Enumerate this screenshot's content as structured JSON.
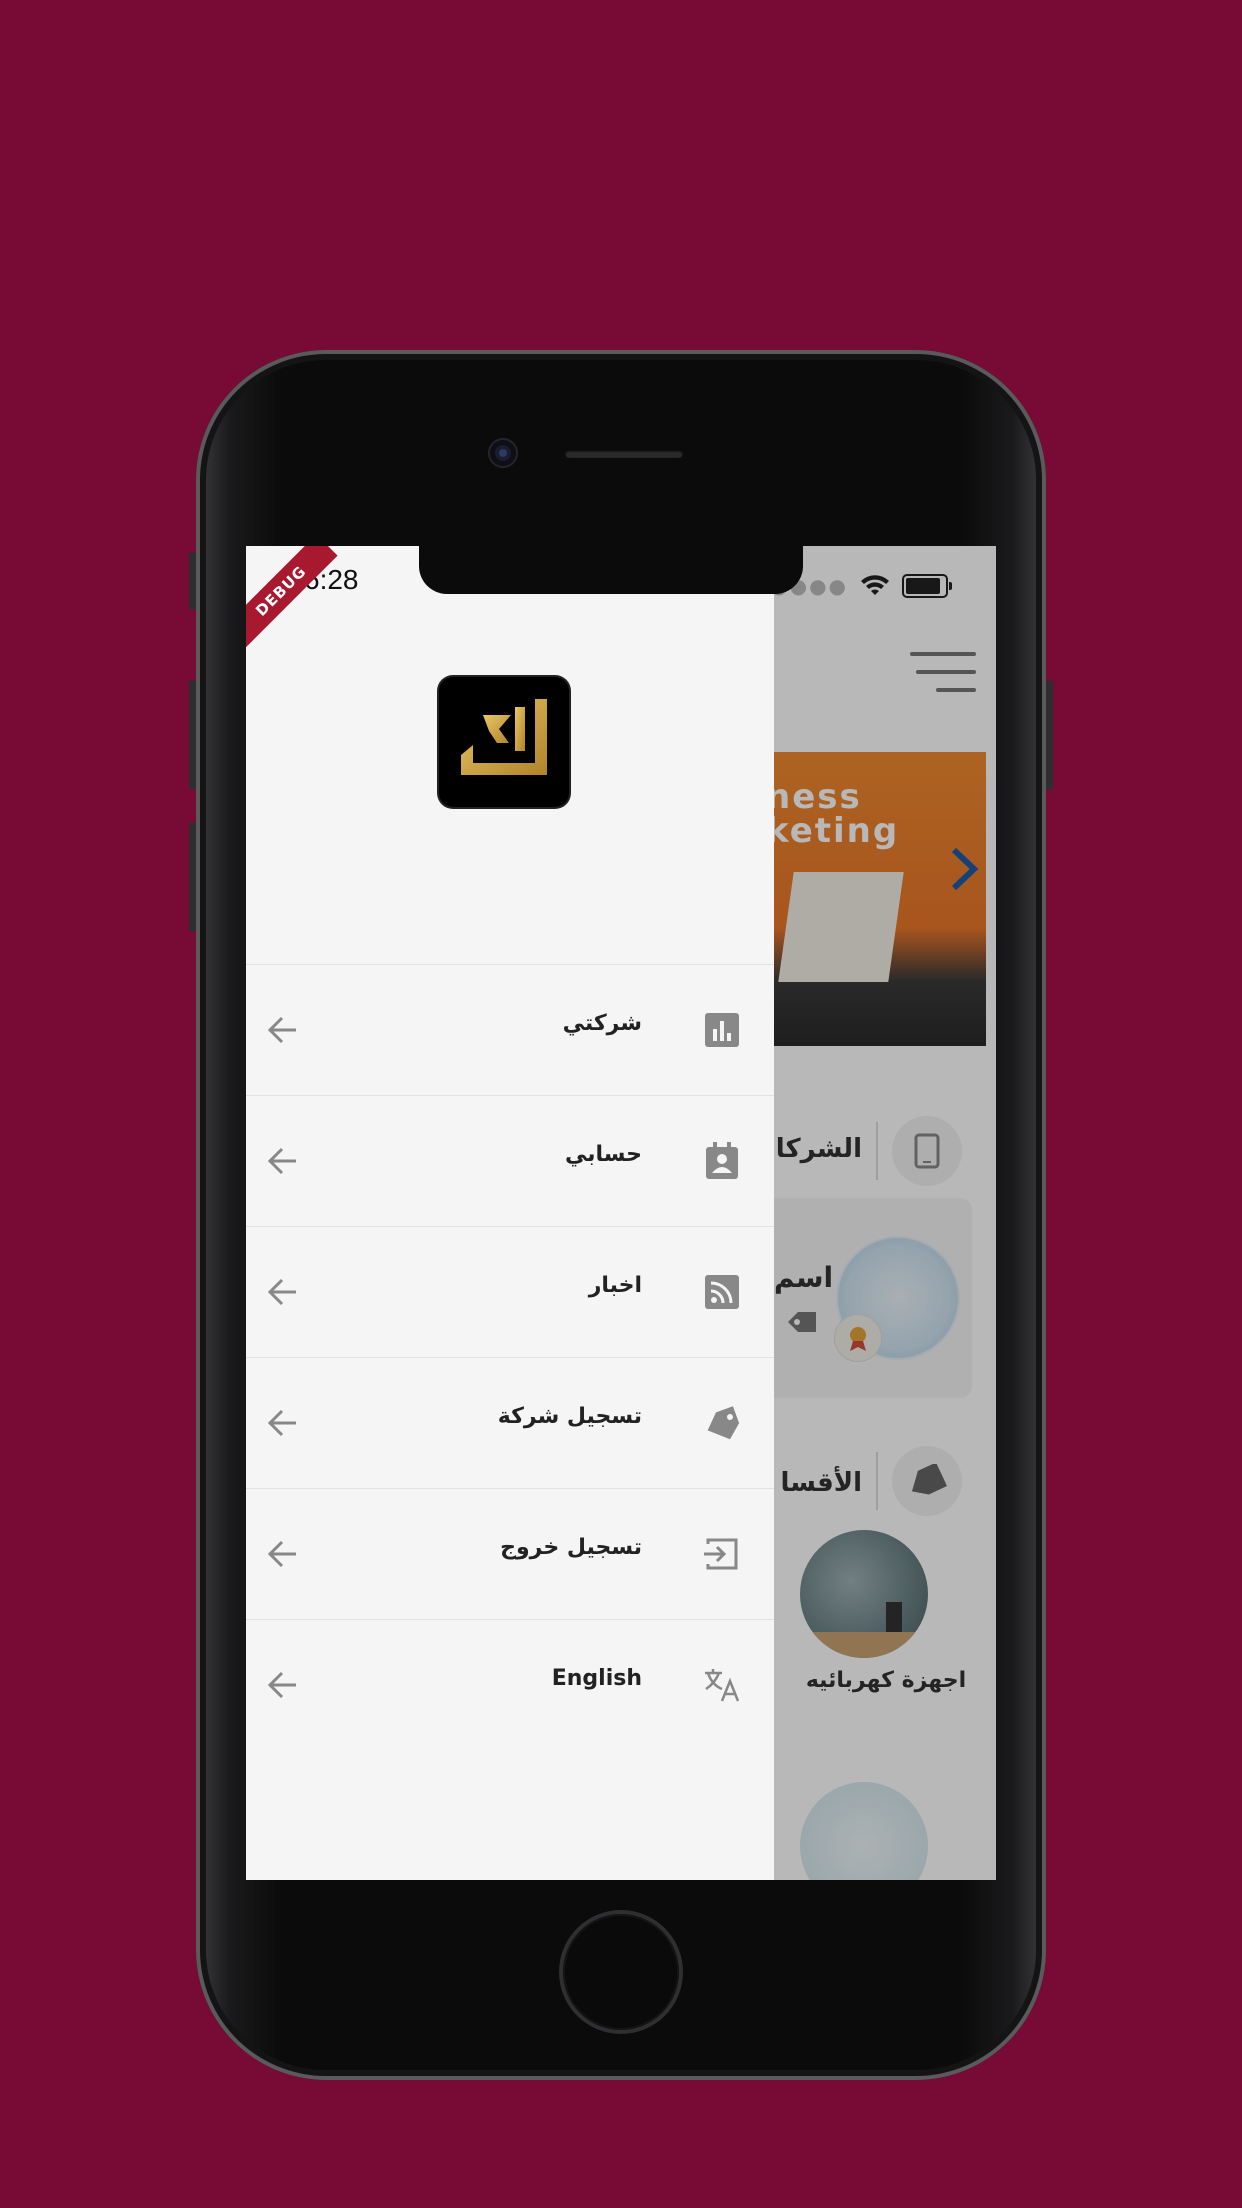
{
  "status_bar": {
    "time": "6:28",
    "debug_banner": "DEBUG"
  },
  "drawer": {
    "items": [
      {
        "label": "شركتي",
        "icon": "bar-chart-icon"
      },
      {
        "label": "حسابي",
        "icon": "contact-card-icon"
      },
      {
        "label": "اخبار",
        "icon": "rss-feed-icon"
      },
      {
        "label": "تسجيل شركة",
        "icon": "tag-icon"
      },
      {
        "label": "تسجيل خروج",
        "icon": "logout-icon"
      },
      {
        "label": "English",
        "icon": "translate-icon"
      }
    ]
  },
  "background": {
    "banner_text": "ness\nketing",
    "companies_section_title": "الشركا",
    "company_name": "اسم",
    "categories_section_title": "الأقسا",
    "category_label": "اجهزة كهربائيه"
  },
  "colors": {
    "page_background": "#780b35",
    "drawer_background": "#f5f5f5",
    "banner": "#ec7d2c",
    "accent_arrow": "#1e5aa8",
    "logo_gold": "#c9a23a"
  }
}
